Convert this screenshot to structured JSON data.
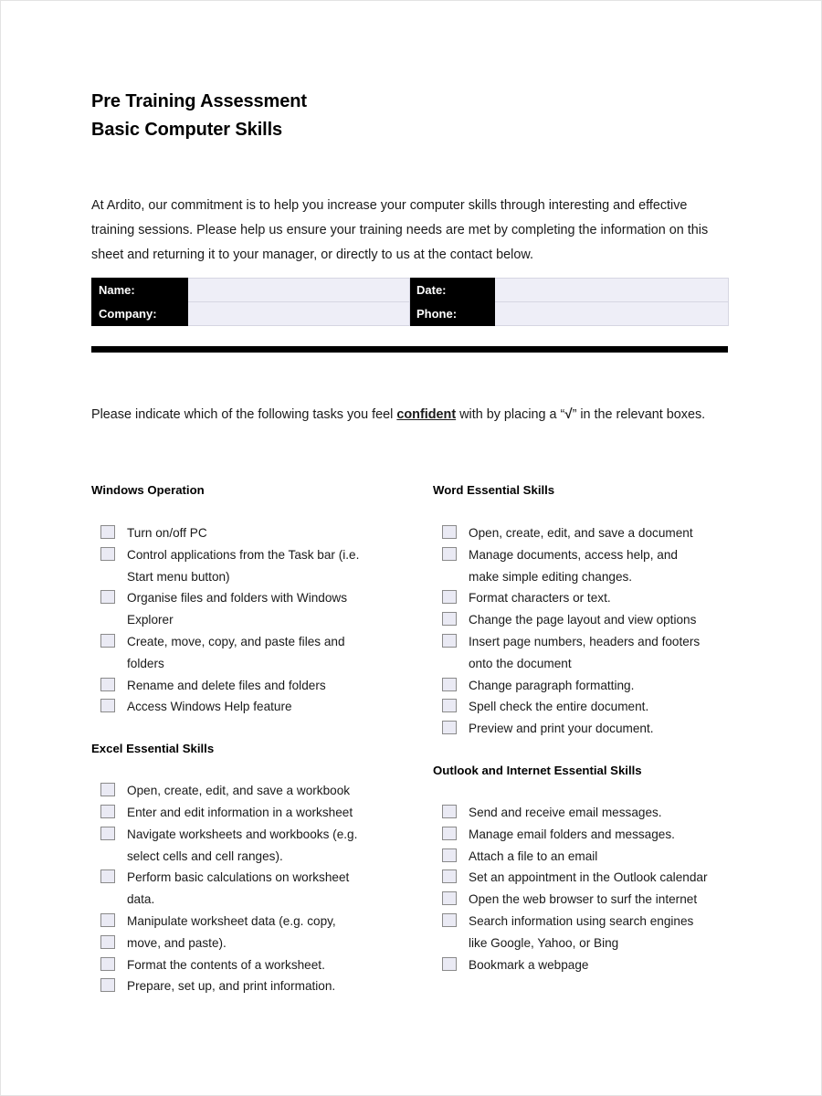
{
  "document": {
    "title_line1": "Pre Training Assessment",
    "title_line2": "Basic Computer Skills",
    "intro": "At Ardito, our commitment is to help you increase your computer skills through interesting and effective training sessions.  Please help us ensure your training needs are met by completing the information on this sheet and returning it to your manager, or directly to us at the contact below.",
    "instruction_part1": "Please indicate which of the following tasks you feel ",
    "instruction_emphasis": "confident",
    "instruction_part2": " with by placing a “",
    "instruction_tick": "√",
    "instruction_part3": "” in the relevant boxes."
  },
  "form_table": {
    "rows": [
      {
        "label_left": "Name:",
        "value_left": "",
        "label_right": "Date:",
        "value_right": ""
      },
      {
        "label_left": "Company:",
        "value_left": "",
        "label_right": "Phone:",
        "value_right": ""
      }
    ]
  },
  "colors": {
    "label_cell_bg": "#000000",
    "label_cell_text": "#ffffff",
    "input_cell_bg": "#eeeef7",
    "checkbox_fill": "#eaeaf4",
    "checkbox_border": "#8a8a8a",
    "divider": "#000000",
    "page_bg": "#ffffff"
  },
  "left_column": {
    "sections": [
      {
        "title": "Windows Operation",
        "items": [
          {
            "text": "Turn on/off PC",
            "continuation": null,
            "checked": false
          },
          {
            "text": "Control applications from the Task bar (i.e.",
            "continuation": "Start menu button)",
            "checked": false
          },
          {
            "text": "Organise files and folders with Windows",
            "continuation": "Explorer",
            "checked": false
          },
          {
            "text": "Create, move, copy, and paste files and",
            "continuation": "folders",
            "checked": false
          },
          {
            "text": "Rename and delete files and folders",
            "continuation": null,
            "checked": false
          },
          {
            "text": "Access Windows Help feature",
            "continuation": null,
            "checked": false
          }
        ]
      },
      {
        "title": "Excel Essential Skills",
        "items": [
          {
            "text": "Open, create, edit, and save a workbook",
            "continuation": null,
            "checked": false
          },
          {
            "text": "Enter and edit information in a worksheet",
            "continuation": null,
            "checked": false
          },
          {
            "text": "Navigate worksheets and workbooks (e.g.",
            "continuation": "select cells and cell ranges).",
            "checked": false
          },
          {
            "text": "Perform basic calculations on worksheet",
            "continuation": "data.",
            "checked": false
          },
          {
            "text": "Manipulate worksheet data (e.g. copy,",
            "continuation": null,
            "checked": false
          },
          {
            "text": "move, and paste).",
            "continuation": null,
            "checked": false
          },
          {
            "text": "Format the contents of a worksheet.",
            "continuation": null,
            "checked": false
          },
          {
            "text": "Prepare, set up, and print information.",
            "continuation": null,
            "checked": false
          }
        ]
      }
    ]
  },
  "right_column": {
    "sections": [
      {
        "title": "Word Essential Skills",
        "items": [
          {
            "text": "Open, create, edit, and save a document",
            "continuation": null,
            "checked": false
          },
          {
            "text": "Manage documents, access help, and",
            "continuation": "make simple editing changes.",
            "checked": false
          },
          {
            "text": "Format characters or text.",
            "continuation": null,
            "checked": false
          },
          {
            "text": "Change the page layout and view options",
            "continuation": null,
            "checked": false
          },
          {
            "text": "Insert page numbers, headers and footers",
            "continuation": "onto the document",
            "checked": false
          },
          {
            "text": "Change paragraph formatting.",
            "continuation": null,
            "checked": false
          },
          {
            "text": "Spell check the entire document.",
            "continuation": null,
            "checked": false
          },
          {
            "text": "Preview and print your document.",
            "continuation": null,
            "checked": false
          }
        ]
      },
      {
        "title": "Outlook and Internet Essential Skills",
        "items": [
          {
            "text": "Send and receive email messages.",
            "continuation": null,
            "checked": false
          },
          {
            "text": "Manage email folders and messages.",
            "continuation": null,
            "checked": false
          },
          {
            "text": "Attach a file to an email",
            "continuation": null,
            "checked": false
          },
          {
            "text": "Set an appointment in the Outlook calendar",
            "continuation": null,
            "checked": false
          },
          {
            "text": "Open the web browser to surf the internet",
            "continuation": null,
            "checked": false
          },
          {
            "text": "Search information using search engines",
            "continuation": "like Google, Yahoo, or Bing",
            "checked": false
          },
          {
            "text": "Bookmark a webpage",
            "continuation": null,
            "checked": false
          }
        ]
      }
    ]
  }
}
